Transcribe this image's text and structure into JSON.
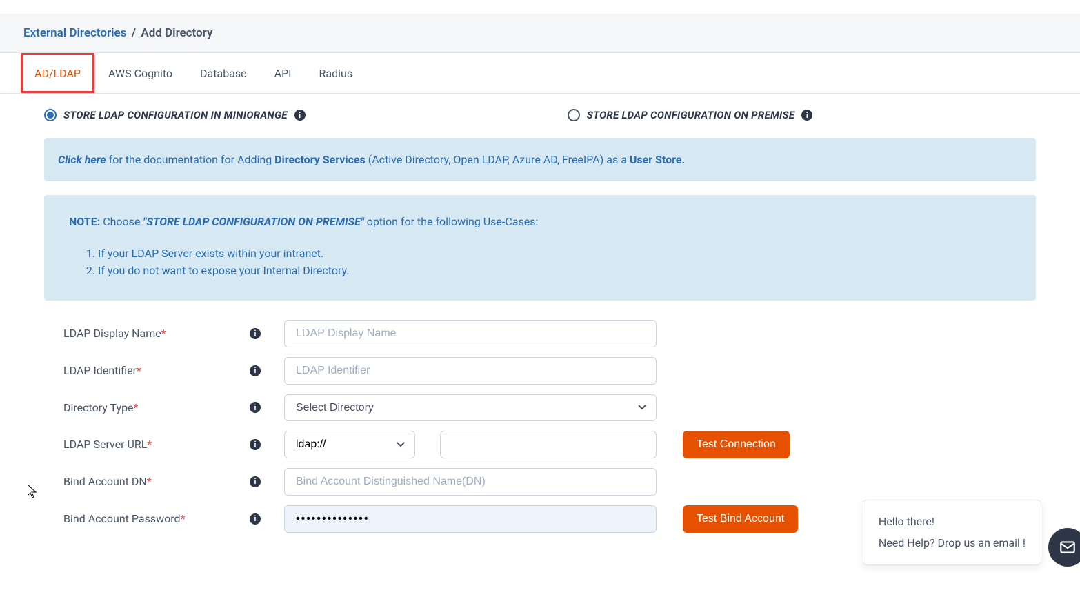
{
  "breadcrumb": {
    "link": "External Directories",
    "sep": "/",
    "current": "Add Directory"
  },
  "tabs": {
    "adldap": "AD/LDAP",
    "cognito": "AWS Cognito",
    "database": "Database",
    "api": "API",
    "radius": "Radius"
  },
  "radios": {
    "miniorange": "STORE LDAP CONFIGURATION IN MINIORANGE",
    "onpremise": "STORE LDAP CONFIGURATION ON PREMISE"
  },
  "alert": {
    "click": "Click here",
    "mid1": " for the documentation for Adding ",
    "bold1": "Directory Services",
    "mid2": " (Active Directory, Open LDAP, Azure AD, FreeIPA) as a ",
    "bold2": "User Store."
  },
  "note": {
    "label": "NOTE:",
    "pre": "  Choose ",
    "quoted": "\"STORE LDAP CONFIGURATION ON PREMISE\"",
    "post": " option for the following Use-Cases:",
    "item1": "If your LDAP Server exists within your intranet.",
    "item2": "If you do not want to expose your Internal Directory."
  },
  "form": {
    "display_name": {
      "label": "LDAP Display Name",
      "placeholder": "LDAP Display Name"
    },
    "identifier": {
      "label": "LDAP Identifier",
      "placeholder": "LDAP Identifier"
    },
    "dir_type": {
      "label": "Directory Type",
      "placeholder": "Select Directory"
    },
    "server_url": {
      "label": "LDAP Server URL",
      "proto": "ldap://"
    },
    "bind_dn": {
      "label": "Bind Account DN",
      "placeholder": "Bind Account Distinguished Name(DN)"
    },
    "bind_pwd": {
      "label": "Bind Account Password",
      "value": "••••••••••••••"
    }
  },
  "buttons": {
    "test_conn": "Test Connection",
    "test_bind": "Test Bind Account"
  },
  "chat": {
    "line1": "Hello there!",
    "line2": "Need Help? Drop us an email !"
  }
}
